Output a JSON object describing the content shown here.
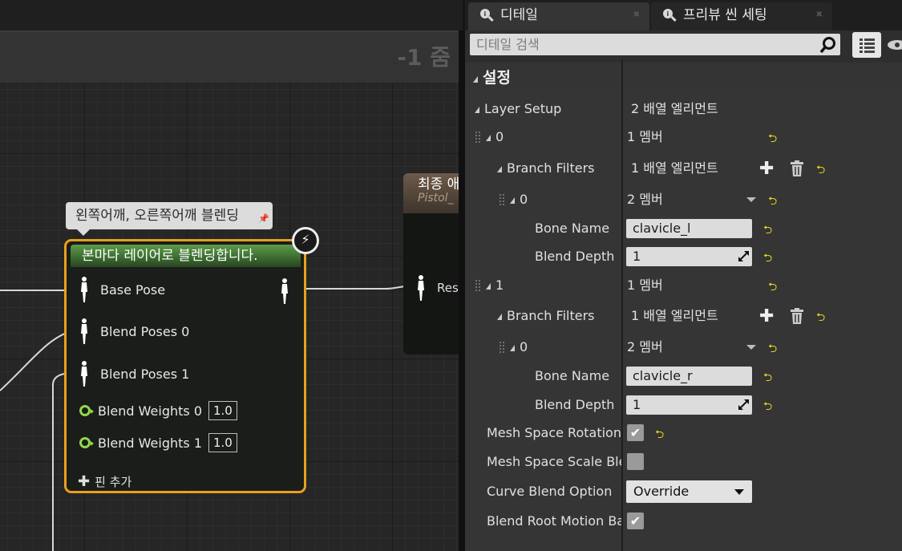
{
  "graph": {
    "zoom_label": "-1 줌",
    "comment": "왼쪽어깨, 오른쪽어깨 블렌딩",
    "node": {
      "title": "본마다 레이어로 블렌딩합니다.",
      "pins": {
        "base_pose": "Base Pose",
        "blend_poses_0": "Blend Poses 0",
        "blend_poses_1": "Blend Poses 1",
        "blend_weights_0": "Blend Weights 0",
        "blend_weights_0_value": "1.0",
        "blend_weights_1": "Blend Weights 1",
        "blend_weights_1_value": "1.0"
      },
      "add_pin": "핀 추가"
    },
    "final_node": {
      "title": "최종 애",
      "subtitle": "Pistol_",
      "pin": "Res"
    }
  },
  "details": {
    "tabs": [
      {
        "label": "디테일"
      },
      {
        "label": "프리뷰 씬 세팅"
      }
    ],
    "search_placeholder": "디테일 검색",
    "category": "설정",
    "rows": {
      "layer_setup": {
        "label": "Layer Setup",
        "value": "2 배열 엘리먼트"
      },
      "layer0": {
        "label": "0",
        "value": "1 멤버"
      },
      "layer0_branch_filters": {
        "label": "Branch Filters",
        "value": "1 배열 엘리먼트"
      },
      "layer0_filter0": {
        "label": "0",
        "value": "2 멤버"
      },
      "layer0_bone_name": {
        "label": "Bone Name",
        "value": "clavicle_l"
      },
      "layer0_blend_depth": {
        "label": "Blend Depth",
        "value": "1"
      },
      "layer1": {
        "label": "1",
        "value": "1 멤버"
      },
      "layer1_branch_filters": {
        "label": "Branch Filters",
        "value": "1 배열 엘리먼트"
      },
      "layer1_filter0": {
        "label": "0",
        "value": "2 멤버"
      },
      "layer1_bone_name": {
        "label": "Bone Name",
        "value": "clavicle_r"
      },
      "layer1_blend_depth": {
        "label": "Blend Depth",
        "value": "1"
      },
      "mesh_space_rotation": {
        "label": "Mesh Space Rotation Bl",
        "checked": true
      },
      "mesh_space_scale": {
        "label": "Mesh Space Scale Blend",
        "checked": false
      },
      "curve_blend_option": {
        "label": "Curve Blend Option",
        "value": "Override"
      },
      "blend_root_motion": {
        "label": "Blend Root Motion Base",
        "checked": true
      }
    }
  },
  "colors": {
    "node_border": "#e8a01e",
    "node_header": "#4f8a3e",
    "float_pin": "#8fd94c",
    "reset_arrow": "#e6d81f"
  }
}
